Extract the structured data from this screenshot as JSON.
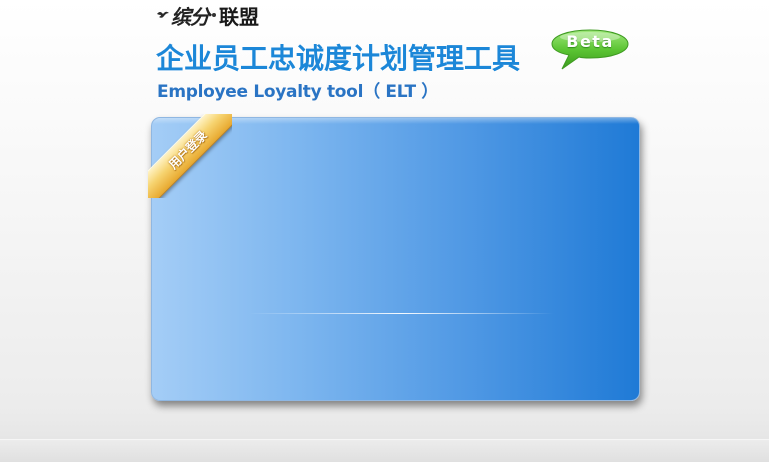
{
  "logo": {
    "part1": "缤分",
    "part2": "联盟",
    "icon": "bird-icon"
  },
  "header": {
    "title_cn": "企业员工忠诚度计划管理工具",
    "title_en": "Employee Loyalty tool（ ELT ）",
    "beta_badge": "Beta"
  },
  "login_panel": {
    "ribbon_label": "用户登录"
  },
  "colors": {
    "title_blue": "#1c87d8",
    "subtitle_blue": "#2a74c4",
    "panel_left": "#a4cdf6",
    "panel_right": "#1f7ad6",
    "beta_green": "#4fbb2a",
    "ribbon_gold": "#f6d36f"
  }
}
